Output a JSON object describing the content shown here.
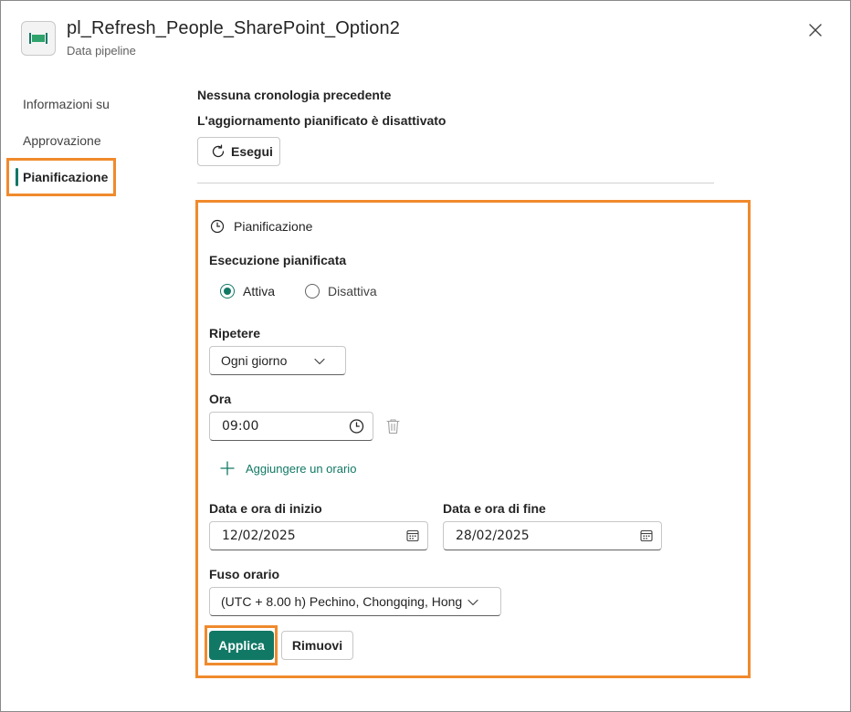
{
  "header": {
    "title": "pl_Refresh_People_SharePoint_Option2",
    "subtitle": "Data pipeline"
  },
  "nav": {
    "items": [
      {
        "label": "Informazioni su"
      },
      {
        "label": "Approvazione"
      },
      {
        "label": "Pianificazione"
      }
    ],
    "active": "Pianificazione"
  },
  "status": {
    "history": "Nessuna cronologia precedente",
    "schedule_state": "L'aggiornamento pianificato è disattivato",
    "run_label": "Esegui"
  },
  "schedule": {
    "section_title": "Pianificazione",
    "scheduled_run_label": "Esecuzione pianificata",
    "on_label": "Attiva",
    "off_label": "Disattiva",
    "selected": "Attiva",
    "repeat_label": "Ripetere",
    "repeat_value": "Ogni giorno",
    "time_label": "Ora",
    "time_value": "09:00",
    "add_time_label": "Aggiungere un orario",
    "start_label": "Data e ora di inizio",
    "start_value": "12/02/2025",
    "end_label": "Data e ora di fine",
    "end_value": "28/02/2025",
    "timezone_label": "Fuso orario",
    "timezone_value": "(UTC + 8.00 h) Pechino, Chongqing, Hong",
    "apply_label": "Applica",
    "remove_label": "Rimuovi"
  },
  "colors": {
    "accent": "#117865",
    "highlight": "#f08a2c"
  }
}
